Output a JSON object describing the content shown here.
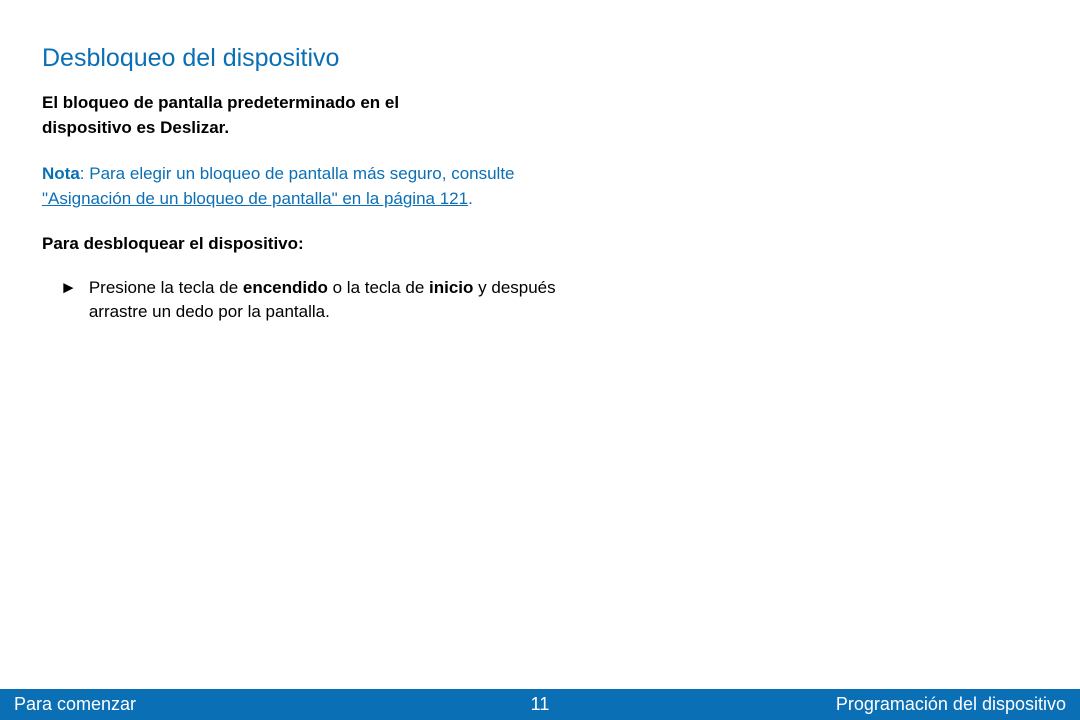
{
  "heading": "Desbloqueo del dispositivo",
  "intro": "El bloqueo de pantalla predeterminado en el dispositivo es Deslizar.",
  "note": {
    "label": "Nota",
    "text_before_link": ": Para elegir un bloqueo de pantalla más seguro, consulte ",
    "link_text": "\"Asignación de un bloqueo de pantalla\" en la página 121",
    "period": "."
  },
  "subhead": "Para desbloquear el dispositivo:",
  "instruction": {
    "arrow": "►",
    "parts": {
      "p1": "Presione la tecla de ",
      "b1": "encendido",
      "p2": " o la tecla de ",
      "b2": "inicio",
      "p3": " y después arrastre un dedo por la pantalla."
    }
  },
  "footer": {
    "left": "Para comenzar",
    "center": "11",
    "right": "Programación del dispositivo"
  }
}
